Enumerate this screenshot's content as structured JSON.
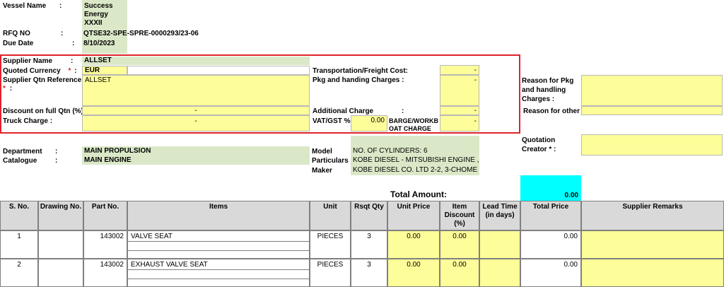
{
  "header": {
    "vessel_label": "Vessel Name",
    "vessel_value_lines": [
      "Success",
      "Energy",
      "XXXII"
    ],
    "rfq_label": "RFQ NO",
    "rfq_value": "QTSE32-SPE-SPRE-0000293/23-06",
    "due_label": "Due Date",
    "due_value": "8/10/2023",
    "colon": ":"
  },
  "supplier": {
    "name_label": "Supplier Name",
    "name_value": "ALLSET",
    "currency_label": "Quoted Currency",
    "currency_value": "EUR",
    "qtn_ref_label": "Supplier Qtn Reference",
    "qtn_ref_value": "ALLSET",
    "discount_label": "Discount on full Qtn  (%)",
    "discount_value": "-",
    "truck_label": "Truck Charge :",
    "truck_value": "-",
    "transport_label": "Transportation/Freight Cost:",
    "transport_value": "-",
    "pkg_label": "Pkg and handing Charges  :",
    "pkg_value": "-",
    "additional_label": "Additional Charge",
    "additional_value": "-",
    "vat_label": "VAT/GST %",
    "vat_value": "0.00",
    "barge_label_lines": [
      "BARGE/WORKB",
      "OAT CHARGE"
    ],
    "barge_value": "-",
    "required_mark": "*"
  },
  "reasons": {
    "pkg_reason_lines": [
      "Reason for Pkg",
      "and handling",
      "Charges :"
    ],
    "other_reason": "Reason for other",
    "creator_lines": [
      "Quotation",
      "Creator * :"
    ]
  },
  "equipment": {
    "department_label": "Department",
    "department_value": "MAIN PROPULSION",
    "catalogue_label": "Catalogue",
    "catalogue_value": "MAIN ENGINE",
    "model_label": "Model",
    "model_value": "NO. OF CYLINDERS: 6",
    "particulars_label": "Particulars",
    "particulars_value": "KOBE DIESEL - MITSUBISHI ENGINE ,",
    "maker_label": "Maker",
    "maker_value": "KOBE DIESEL CO. LTD 2-2, 3-CHOME"
  },
  "totals": {
    "label": "Total Amount:",
    "value": "0.00"
  },
  "table": {
    "columns": [
      "S. No.",
      "Drawing No.",
      "Part No.",
      "Items",
      "Unit",
      "Rsqt Qty",
      "Unit Price",
      "Item Discount (%)",
      "Lead Time (in days)",
      "Total Price",
      "Supplier Remarks"
    ],
    "discount_header_lines": [
      "Item",
      "Discount",
      "(%)"
    ],
    "lead_header_lines": [
      "Lead Time",
      "(in days)"
    ],
    "rows": [
      {
        "sno": "1",
        "drawing": "",
        "part": "143002",
        "item": "VALVE SEAT",
        "unit": "PIECES",
        "qty": "3",
        "unit_price": "0.00",
        "discount": "0.00",
        "lead": "",
        "total": "0.00",
        "remarks": ""
      },
      {
        "sno": "2",
        "drawing": "",
        "part": "143002",
        "item": "EXHAUST VALVE SEAT",
        "unit": "PIECES",
        "qty": "3",
        "unit_price": "0.00",
        "discount": "0.00",
        "lead": "",
        "total": "0.00",
        "remarks": ""
      }
    ]
  }
}
